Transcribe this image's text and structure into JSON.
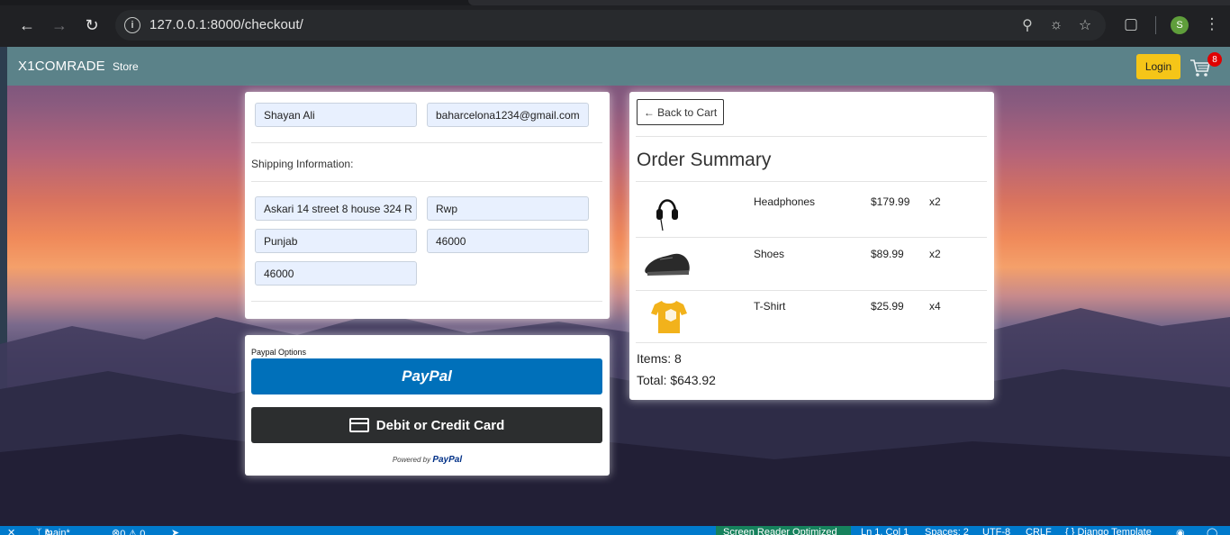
{
  "browser": {
    "url": "127.0.0.1:8000/checkout/",
    "profile_initial": "S"
  },
  "navbar": {
    "brand": "X1COMRADE",
    "store_link": "Store",
    "login_label": "Login",
    "cart_count": "8"
  },
  "user_info": {
    "name": "Shayan Ali",
    "email": "baharcelona1234@gmail.com"
  },
  "shipping": {
    "heading": "Shipping Information:",
    "address": "Askari 14 street 8 house 324 R",
    "city": "Rwp",
    "state": "Punjab",
    "zipcode": "46000",
    "country": "46000"
  },
  "payment": {
    "options_label": "Paypal Options",
    "paypal_button": "PayPal",
    "card_button": "Debit or Credit Card",
    "powered_by": "Powered by",
    "powered_brand": "PayPal"
  },
  "summary": {
    "back_label": "← Back to Cart",
    "title": "Order Summary",
    "items": [
      {
        "name": "Headphones",
        "price": "$179.99",
        "qty": "x2",
        "icon": "headphones-image"
      },
      {
        "name": "Shoes",
        "price": "$89.99",
        "qty": "x2",
        "icon": "shoes-image"
      },
      {
        "name": "T-Shirt",
        "price": "$25.99",
        "qty": "x4",
        "icon": "tshirt-image"
      }
    ],
    "items_total": "Items: 8",
    "price_total": "Total: $643.92"
  },
  "statusbar": {
    "branch": "main*",
    "problems": "0 ⚠ 0",
    "screen_reader": "Screen Reader Optimized",
    "position": "Ln 1, Col 1",
    "spaces": "Spaces: 2",
    "encoding": "UTF-8",
    "eol": "CRLF",
    "language": "{ } Django Template"
  },
  "colors": {
    "navbar": "#5b8289",
    "login": "#f5c518",
    "paypal": "#0070ba",
    "card_button": "#2c2e2f",
    "statusbar": "#007acc"
  }
}
